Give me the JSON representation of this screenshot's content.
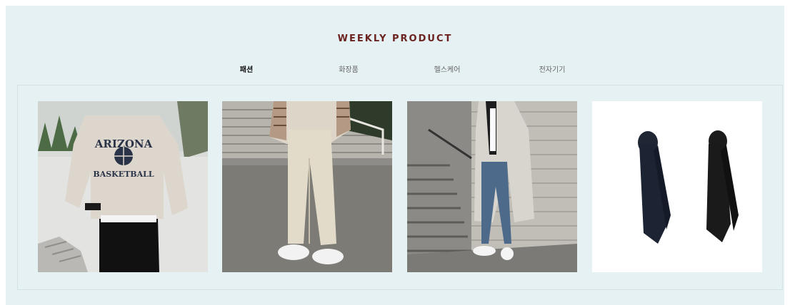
{
  "section": {
    "title": "WEEKLY PRODUCT",
    "tabs": [
      {
        "label": "패션",
        "active": true
      },
      {
        "label": "화장품",
        "active": false
      },
      {
        "label": "헬스케어",
        "active": false
      },
      {
        "label": "전자기기",
        "active": false
      }
    ],
    "products": [
      {
        "image": "sweatshirt-photo",
        "print_line1": "ARIZONA",
        "print_line2": "BASKETBALL"
      },
      {
        "image": "cream-pants-photo"
      },
      {
        "image": "trench-coat-photo"
      },
      {
        "image": "neckties-photo"
      }
    ]
  },
  "colors": {
    "background": "#e6f1f4",
    "title": "#6b2320",
    "active_tab": "#111111",
    "inactive_tab": "#666666"
  }
}
